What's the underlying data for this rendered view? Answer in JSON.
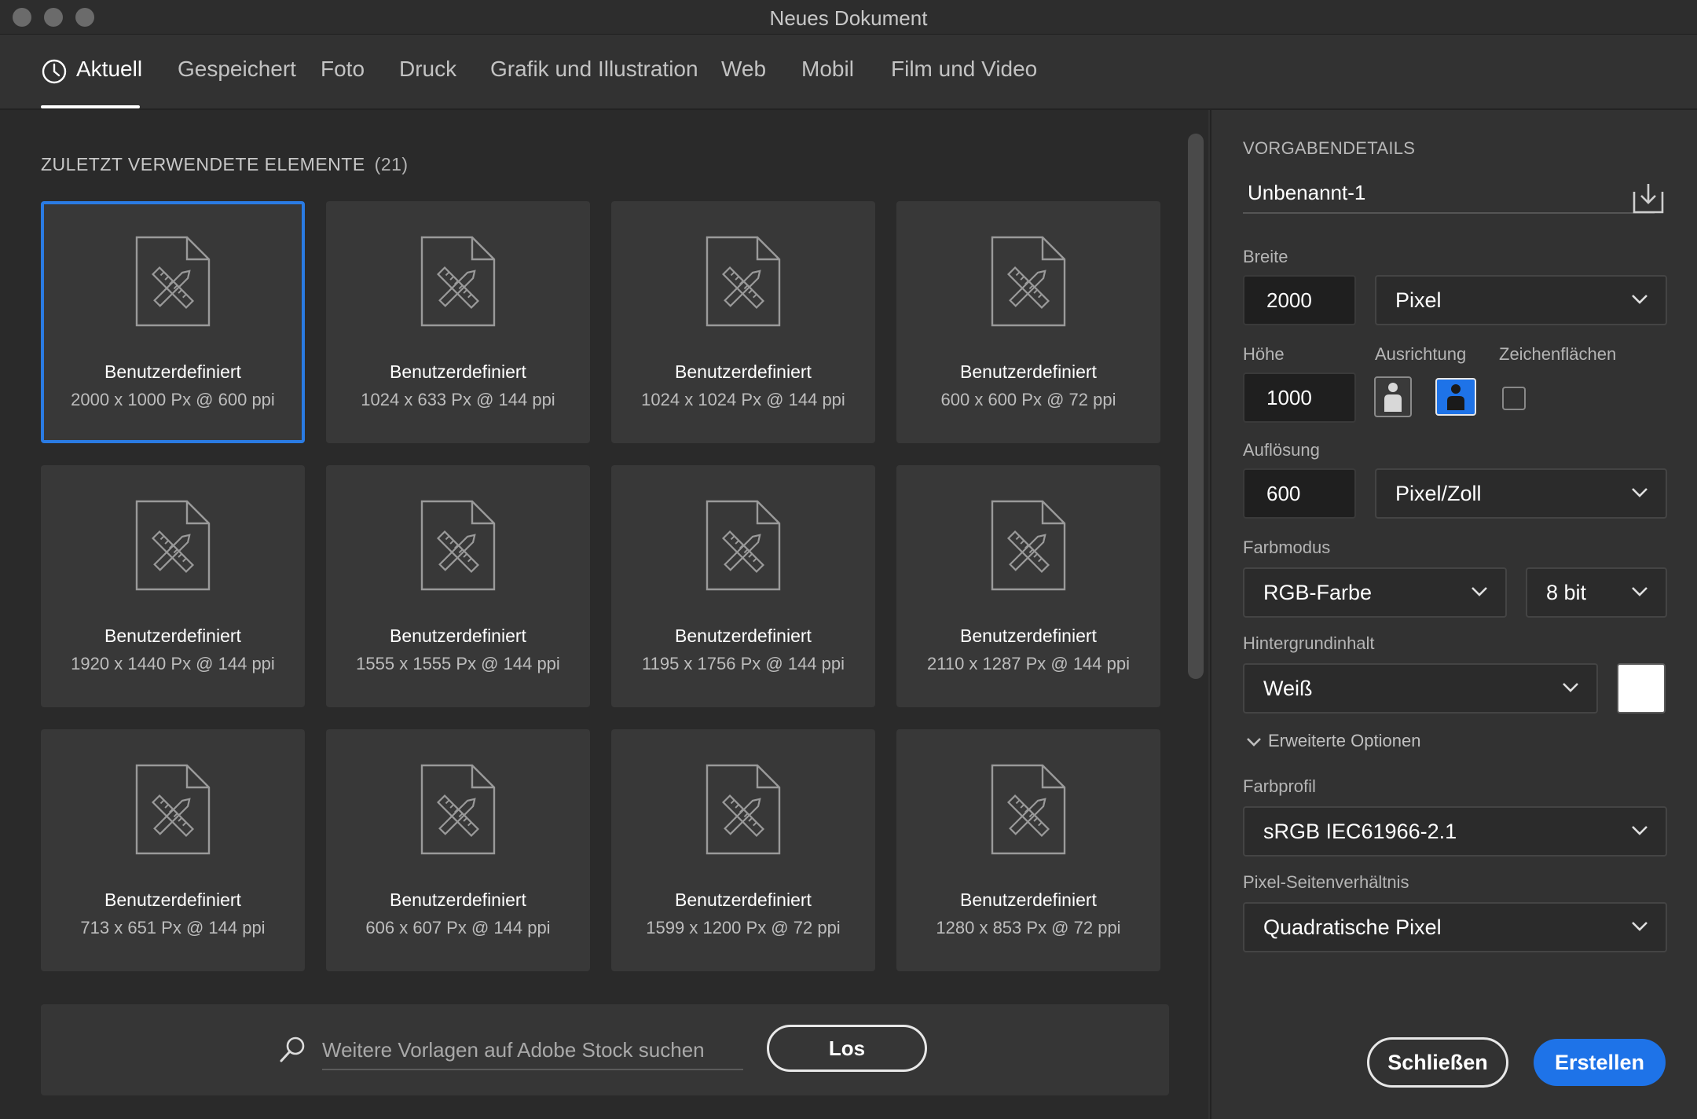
{
  "window": {
    "title": "Neues Dokument"
  },
  "tabs": [
    {
      "label": "Aktuell",
      "active": true
    },
    {
      "label": "Gespeichert"
    },
    {
      "label": "Foto"
    },
    {
      "label": "Druck"
    },
    {
      "label": "Grafik und Illustration"
    },
    {
      "label": "Web"
    },
    {
      "label": "Mobil"
    },
    {
      "label": "Film und Video"
    }
  ],
  "recent": {
    "title": "ZULETZT VERWENDETE ELEMENTE",
    "count": "(21)",
    "items": [
      {
        "name": "Benutzerdefiniert",
        "size": "2000 x 1000 Px @ 600 ppi",
        "selected": true
      },
      {
        "name": "Benutzerdefiniert",
        "size": "1024 x 633 Px @ 144 ppi"
      },
      {
        "name": "Benutzerdefiniert",
        "size": "1024 x 1024 Px @ 144 ppi"
      },
      {
        "name": "Benutzerdefiniert",
        "size": "600 x 600 Px @ 72 ppi"
      },
      {
        "name": "Benutzerdefiniert",
        "size": "1920 x 1440 Px @ 144 ppi"
      },
      {
        "name": "Benutzerdefiniert",
        "size": "1555 x 1555 Px @ 144 ppi"
      },
      {
        "name": "Benutzerdefiniert",
        "size": "1195 x 1756 Px @ 144 ppi"
      },
      {
        "name": "Benutzerdefiniert",
        "size": "2110 x 1287 Px @ 144 ppi"
      },
      {
        "name": "Benutzerdefiniert",
        "size": "713 x 651 Px @ 144 ppi"
      },
      {
        "name": "Benutzerdefiniert",
        "size": "606 x 607 Px @ 144 ppi"
      },
      {
        "name": "Benutzerdefiniert",
        "size": "1599 x 1200 Px @ 72 ppi"
      },
      {
        "name": "Benutzerdefiniert",
        "size": "1280 x 853 Px @ 72 ppi"
      }
    ]
  },
  "search": {
    "placeholder": "Weitere Vorlagen auf Adobe Stock suchen",
    "button_label": "Los"
  },
  "details": {
    "heading": "VORGABENDETAILS",
    "document_name": "Unbenannt-1",
    "width_label": "Breite",
    "width_value": "2000",
    "width_unit": "Pixel",
    "height_label": "Höhe",
    "height_value": "1000",
    "orientation_label": "Ausrichtung",
    "artboards_label": "Zeichenflächen",
    "resolution_label": "Auflösung",
    "resolution_value": "600",
    "resolution_unit": "Pixel/Zoll",
    "color_mode_label": "Farbmodus",
    "color_mode": "RGB-Farbe",
    "bit_depth": "8 bit",
    "background_label": "Hintergrundinhalt",
    "background": "Weiß",
    "background_color": "#ffffff",
    "advanced_label": "Erweiterte Optionen",
    "color_profile_label": "Farbprofil",
    "color_profile": "sRGB IEC61966-2.1",
    "pixel_aspect_label": "Pixel-Seitenverhältnis",
    "pixel_aspect": "Quadratische Pixel"
  },
  "actions": {
    "close_label": "Schließen",
    "create_label": "Erstellen"
  },
  "colors": {
    "accent": "#1e73e8",
    "selection_border": "#2a7be3"
  }
}
